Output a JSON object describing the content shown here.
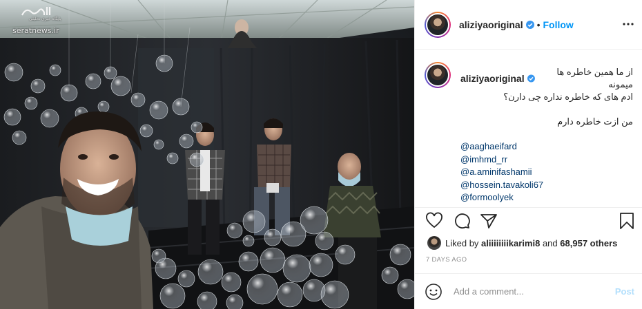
{
  "watermark": {
    "sub": "پایگاه خبری تحلیلی",
    "site": "seratnews.ir"
  },
  "header": {
    "username": "aliziyaoriginal",
    "follow_label": "Follow",
    "separator": "•"
  },
  "caption": {
    "username": "aliziyaoriginal",
    "line1": "از ما همین خاطره ها میمونه",
    "line2": "ادم های که خاطره نداره چی دارن؟",
    "line3": "من ازت خاطره دارم",
    "mentions": [
      "@aaghaeifard",
      "@imhmd_rr",
      "@a.aminifashamii",
      "@hossein.tavakoli67",
      "@formoolyek"
    ]
  },
  "likes": {
    "prefix": "Liked by",
    "user": "aliiiiiiiikarimi8",
    "connector": "and",
    "others": "68,957 others"
  },
  "date": "7 DAYS AGO",
  "comment": {
    "placeholder": "Add a comment...",
    "post_label": "Post"
  },
  "icons": {
    "verified": "verified-badge-icon",
    "more": "more-options-icon",
    "like": "heart-icon",
    "comment": "comment-icon",
    "share": "share-icon",
    "save": "bookmark-icon",
    "emoji": "emoji-icon"
  },
  "colors": {
    "accent": "#0095f6",
    "mention": "#00376b",
    "muted": "#8e8e8e",
    "post_disabled": "#b2dffc"
  }
}
